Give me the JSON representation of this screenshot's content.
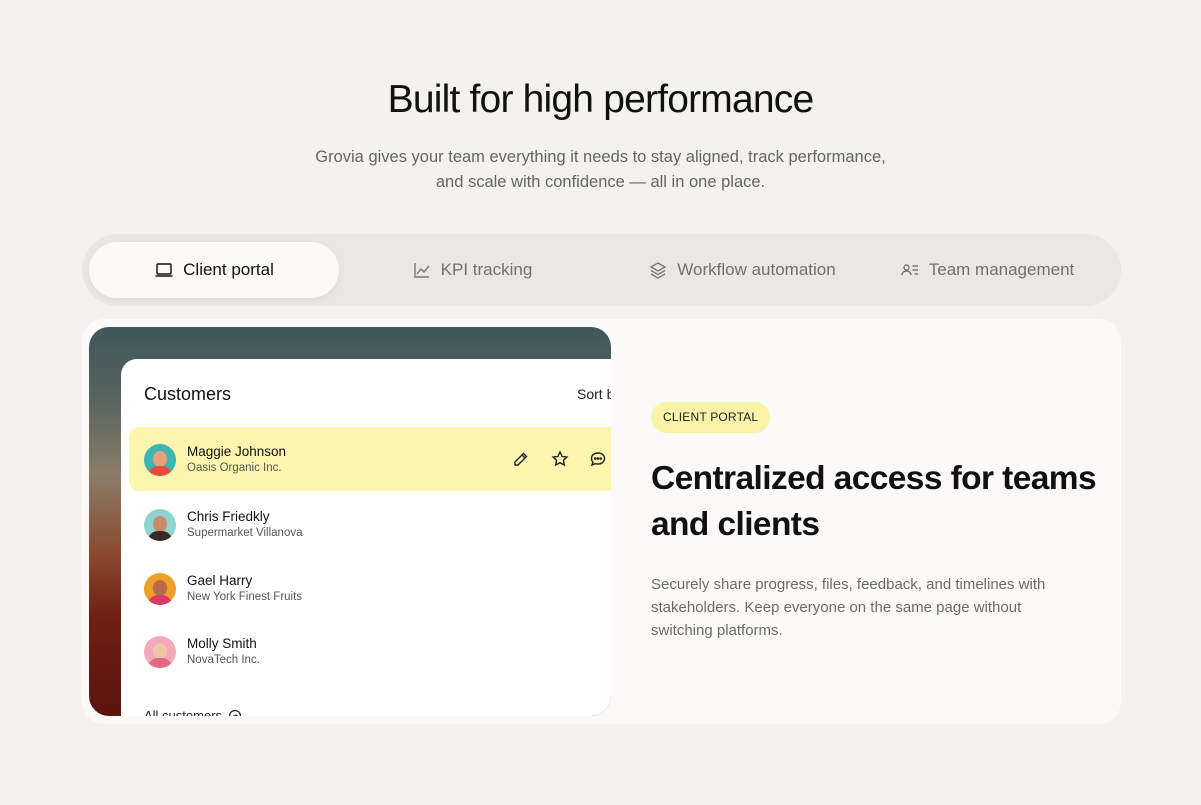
{
  "hero": {
    "title": "Built for high performance",
    "subtitle_line1": "Grovia gives your team everything it needs to stay aligned, track performance,",
    "subtitle_line2": "and scale with confidence — all in one place."
  },
  "tabs": [
    {
      "label": "Client portal",
      "icon": "laptop-icon",
      "active": true
    },
    {
      "label": "KPI tracking",
      "icon": "line-chart-icon",
      "active": false
    },
    {
      "label": "Workflow automation",
      "icon": "layers-icon",
      "active": false
    },
    {
      "label": "Team management",
      "icon": "user-list-icon",
      "active": false
    }
  ],
  "customers_panel": {
    "title": "Customers",
    "sort_label": "Sort b",
    "all_link": "All customers",
    "customers": [
      {
        "name": "Maggie Johnson",
        "company": "Oasis Organic Inc.",
        "highlighted": true
      },
      {
        "name": "Chris Friedkly",
        "company": "Supermarket Villanova",
        "highlighted": false
      },
      {
        "name": "Gael Harry",
        "company": "New York Finest Fruits",
        "highlighted": false
      },
      {
        "name": "Molly Smith",
        "company": "NovaTech Inc.",
        "highlighted": false
      }
    ]
  },
  "feature": {
    "badge": "CLIENT PORTAL",
    "title": "Centralized access for teams and clients",
    "description": "Securely share progress, files, feedback, and timelines with stakeholders. Keep everyone on the same page without switching platforms."
  },
  "colors": {
    "background": "#f3f2ee",
    "highlight": "#fdf6ae",
    "badge": "#fbf3a8"
  }
}
